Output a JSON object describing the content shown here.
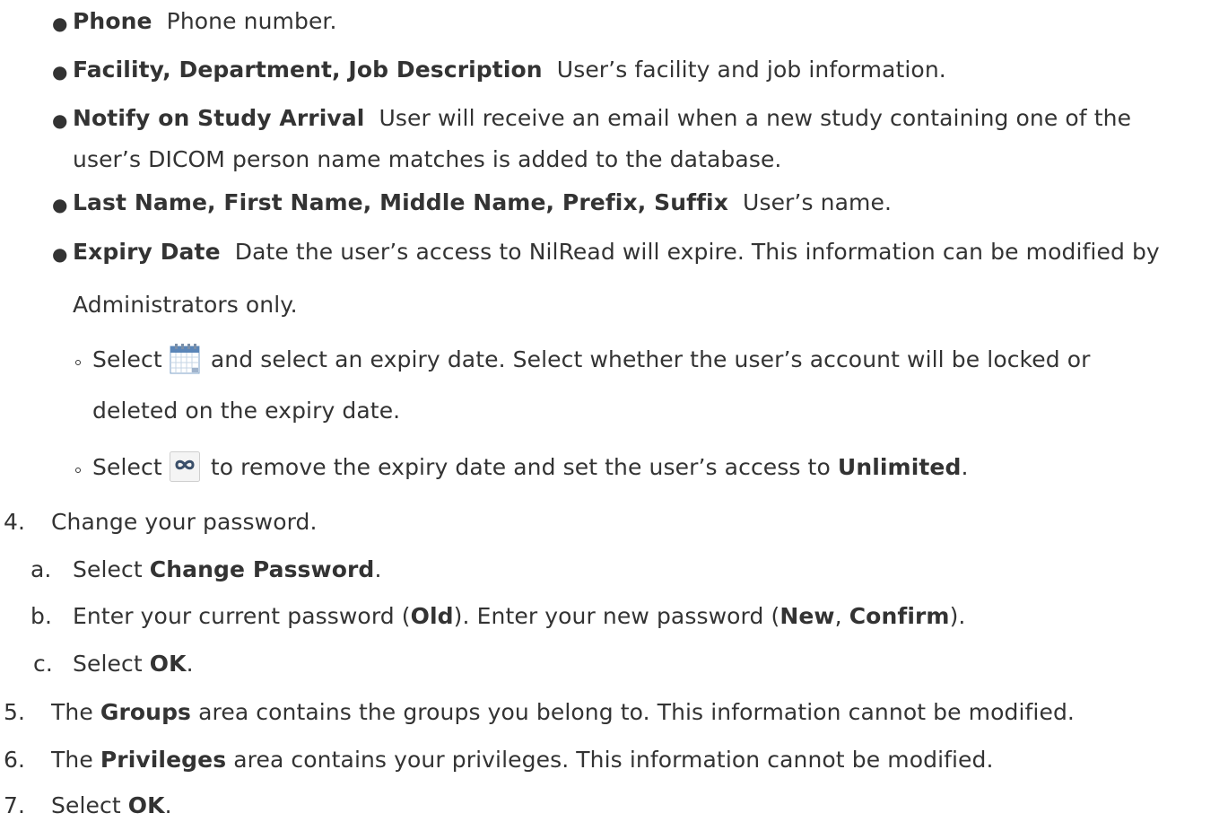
{
  "fields": [
    {
      "term": "Phone",
      "desc": "Phone number."
    },
    {
      "term": "Facility, Department, Job Description",
      "desc": "User’s facility and job information."
    },
    {
      "term": "Notify on Study Arrival",
      "desc": "User will receive an email when a new study containing one of the",
      "desc_cont": "user’s DICOM person name matches is added to the database."
    },
    {
      "term": "Last Name, First Name, Middle Name, Prefix, Suffix",
      "desc": "User’s name."
    },
    {
      "term": "Expiry Date",
      "desc": "Date the user’s access to NilRead will expire. This information can be modified by",
      "desc_cont": "Administrators only."
    }
  ],
  "expiry_sub": [
    {
      "pre": "Select",
      "post": "and select an expiry date. Select whether the user’s account will be locked or",
      "cont": "deleted on the expiry date.",
      "icon": "calendar-icon"
    },
    {
      "pre": "Select",
      "post": "to remove the expiry date and set the user’s access to",
      "bold": "Unlimited",
      "end": ".",
      "icon": "infinity-icon"
    }
  ],
  "step4": {
    "num": "4.",
    "text": "Change your password.",
    "sub": [
      {
        "letter": "a.",
        "pre": "Select",
        "bold": "Change Password",
        "end": "."
      },
      {
        "letter": "b.",
        "pre": "Enter your current password (",
        "bold1": "Old",
        "mid": "). Enter your new password (",
        "bold2": "New",
        "sep": ", ",
        "bold3": "Confirm",
        "end": ")."
      },
      {
        "letter": "c.",
        "pre": "Select",
        "bold": "OK",
        "end": "."
      }
    ]
  },
  "step5": {
    "num": "5.",
    "pre": "The",
    "bold": "Groups",
    "post": "area contains the groups you belong to. This information cannot be modified."
  },
  "step6": {
    "num": "6.",
    "pre": "The",
    "bold": "Privileges",
    "post": "area contains your privileges. This information cannot be modified."
  },
  "step7": {
    "num": "7.",
    "pre": "Select",
    "bold": "OK",
    "end": "."
  }
}
